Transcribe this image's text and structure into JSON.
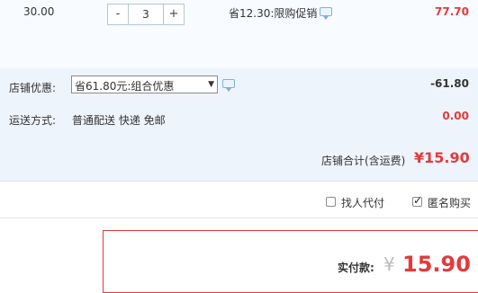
{
  "item": {
    "unit_price": "30.00",
    "qty_minus": "-",
    "quantity": "3",
    "qty_plus": "+",
    "promo": "省12.30:限购促销",
    "total": "77.70"
  },
  "discount": {
    "label": "店铺优惠:",
    "selected": "省61.80元:组合优惠",
    "amount": "-61.80"
  },
  "shipping": {
    "label": "运送方式:",
    "value": "普通配送 快递 免邮",
    "fee": "0.00"
  },
  "store_total": {
    "label": "店铺合计(含运费)",
    "value": "¥15.90"
  },
  "options": {
    "proxy_pay": "找人代付",
    "anonymous": "匿名购买"
  },
  "pay": {
    "label": "实付款:",
    "currency": "¥",
    "value": "15.90"
  },
  "colors": {
    "accent": "#e4393c",
    "row_bg": "#eef4fc"
  },
  "icons": [
    "chat-bubble-icon",
    "checkbox-icon",
    "checkmark-icon",
    "dropdown-arrow-icon"
  ]
}
